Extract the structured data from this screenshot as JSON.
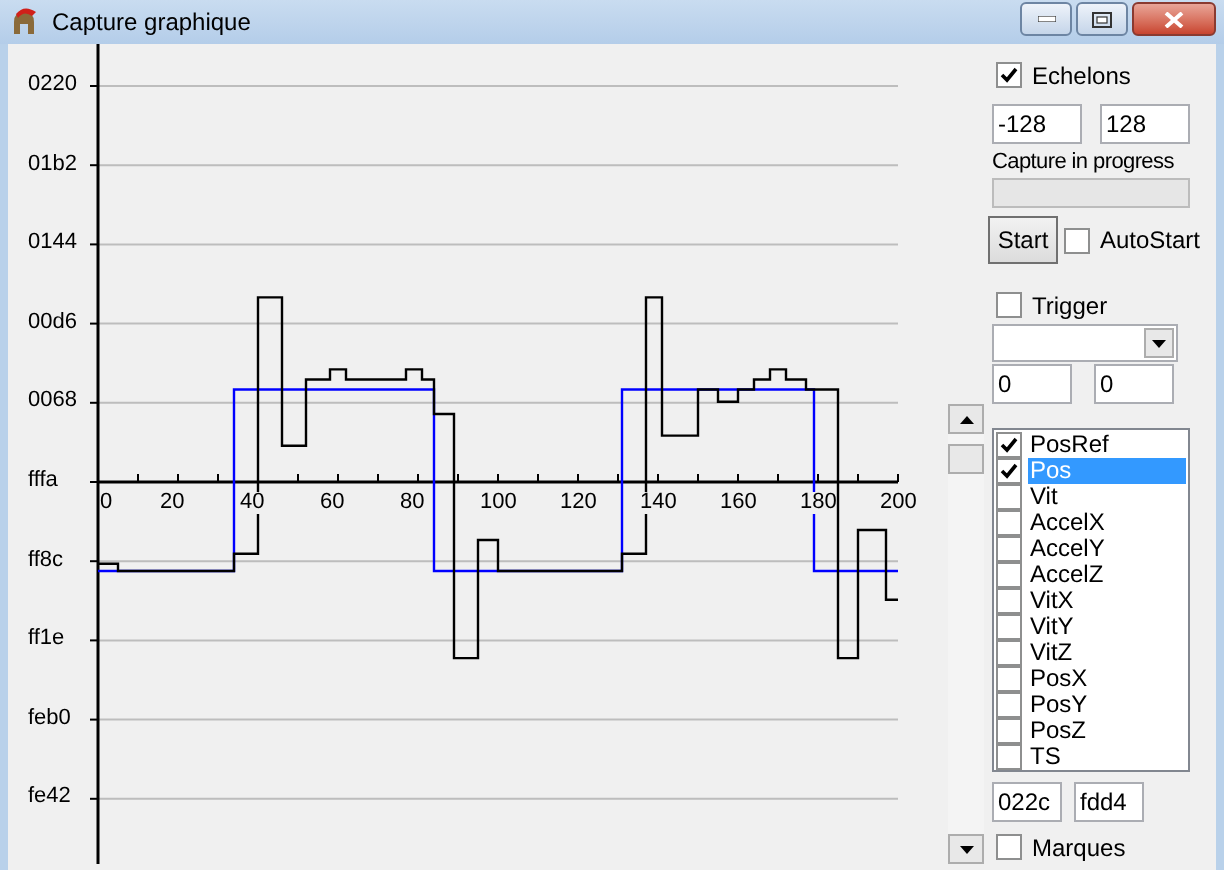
{
  "window": {
    "title": "Capture graphique"
  },
  "plot": {
    "x_labels": [
      "0",
      "20",
      "40",
      "60",
      "80",
      "100",
      "120",
      "140",
      "160",
      "180",
      "200"
    ],
    "y_labels": [
      "0220",
      "01b2",
      "0144",
      "00d6",
      "0068",
      "fffa",
      "ff8c",
      "ff1e",
      "feb0",
      "fe42"
    ]
  },
  "echelons": {
    "label": "Echelons",
    "checked": true
  },
  "range": {
    "min": "-128",
    "max": "128"
  },
  "capture": {
    "label": "Capture in progress",
    "level": 0
  },
  "start_button": "Start",
  "autostart": {
    "label": "AutoStart",
    "checked": false
  },
  "trigger": {
    "label": "Trigger",
    "checked": false
  },
  "trigger_values": [
    "0",
    "0"
  ],
  "channels": [
    {
      "label": "PosRef",
      "checked": true,
      "selected": false
    },
    {
      "label": "Pos",
      "checked": true,
      "selected": true
    },
    {
      "label": "Vit",
      "checked": false,
      "selected": false
    },
    {
      "label": "AccelX",
      "checked": false,
      "selected": false
    },
    {
      "label": "AccelY",
      "checked": false,
      "selected": false
    },
    {
      "label": "AccelZ",
      "checked": false,
      "selected": false
    },
    {
      "label": "VitX",
      "checked": false,
      "selected": false
    },
    {
      "label": "VitY",
      "checked": false,
      "selected": false
    },
    {
      "label": "VitZ",
      "checked": false,
      "selected": false
    },
    {
      "label": "PosX",
      "checked": false,
      "selected": false
    },
    {
      "label": "PosY",
      "checked": false,
      "selected": false
    },
    {
      "label": "PosZ",
      "checked": false,
      "selected": false
    },
    {
      "label": "TS",
      "checked": false,
      "selected": false
    }
  ],
  "bounds": [
    "022c",
    "fdd4"
  ],
  "marques": {
    "label": "Marques",
    "checked": false
  }
}
